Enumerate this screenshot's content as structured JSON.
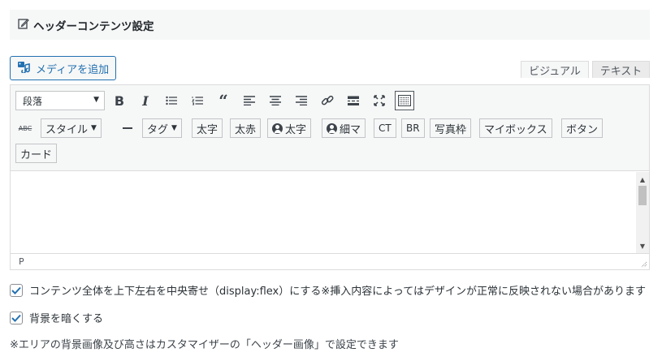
{
  "panel": {
    "title": "ヘッダーコンテンツ設定",
    "icon": "edit-icon"
  },
  "media_button": {
    "label": "メディアを追加",
    "icon": "media-icon"
  },
  "tabs": {
    "visual": "ビジュアル",
    "text": "テキスト"
  },
  "toolbar": {
    "format_select": "段落",
    "row2": {
      "style": "スタイル",
      "tag": "タグ",
      "bold_text": "太字",
      "bold_red": "太赤",
      "person_bold": "太字",
      "person_narrow": "細マ",
      "ct": "CT",
      "br": "BR",
      "photo_frame": "写真枠",
      "my_box": "マイボックス",
      "button": "ボタン"
    },
    "row3": {
      "card": "カード"
    }
  },
  "editor": {
    "status_path": "P"
  },
  "options": [
    {
      "label": "コンテンツ全体を上下左右を中央寄せ（display:flex）にする※挿入内容によってはデザインが正常に反映されない場合があります",
      "checked": true
    },
    {
      "label": "背景を暗くする",
      "checked": true
    }
  ],
  "note": "※エリアの背景画像及び高さはカスタマイザーの「ヘッダー画像」で設定できます",
  "colors": {
    "accent": "#2271b1",
    "toolbar_bg": "#f6f7f7",
    "border": "#dcdcde"
  }
}
